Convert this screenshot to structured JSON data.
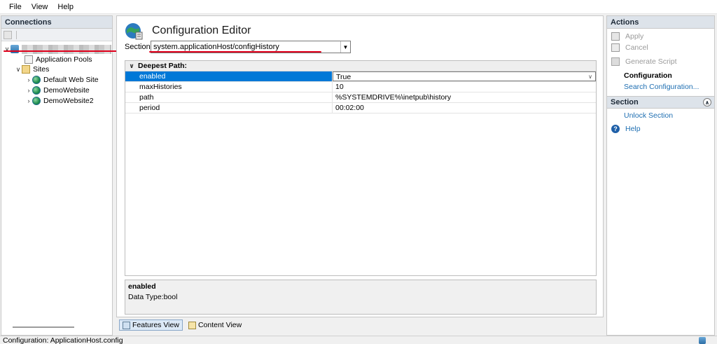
{
  "menu": {
    "file": "File",
    "view": "View",
    "help": "Help"
  },
  "connections": {
    "header": "Connections",
    "tree": {
      "server_label": "",
      "app_pools": "Application Pools",
      "sites": "Sites",
      "site_items": [
        "Default Web Site",
        "DemoWebsite",
        "DemoWebsite2"
      ]
    }
  },
  "editor": {
    "title": "Configuration Editor",
    "section_label": "Section:",
    "section_value": "system.applicationHost/configHistory",
    "group_header": "Deepest Path:",
    "rows": [
      {
        "key": "enabled",
        "value": "True"
      },
      {
        "key": "maxHistories",
        "value": "10"
      },
      {
        "key": "path",
        "value": "%SYSTEMDRIVE%\\inetpub\\history"
      },
      {
        "key": "period",
        "value": "00:02:00"
      }
    ],
    "description": {
      "title": "enabled",
      "text": "Data Type:bool"
    }
  },
  "tabs": {
    "features_view": "Features View",
    "content_view": "Content View"
  },
  "actions": {
    "header": "Actions",
    "apply": "Apply",
    "cancel": "Cancel",
    "generate_script": "Generate Script",
    "configuration": "Configuration",
    "search_configuration": "Search Configuration...",
    "section_header": "Section",
    "unlock_section": "Unlock Section",
    "help": "Help"
  },
  "status": {
    "text": "Configuration: ApplicationHost.config"
  },
  "colors": {
    "selection": "#0078d7",
    "link": "#1f6fb2",
    "annotation": "#e0001b"
  }
}
